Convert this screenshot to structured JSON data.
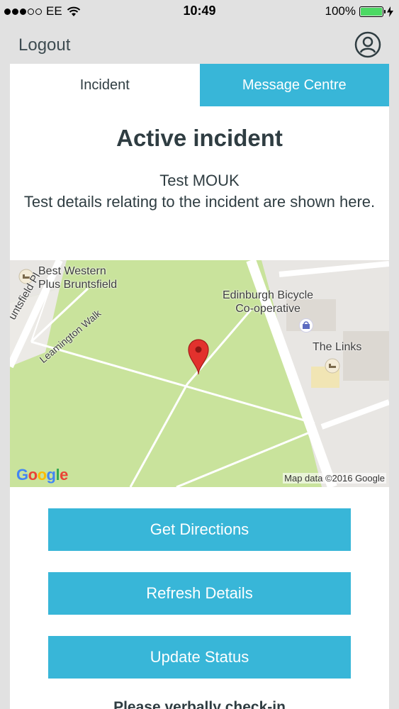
{
  "statusbar": {
    "carrier": "EE",
    "time": "10:49",
    "battery_percent": "100%",
    "battery_level": 1.0
  },
  "nav": {
    "logout_label": "Logout",
    "profile_icon": "user-circle-icon"
  },
  "tabs": [
    {
      "label": "Incident",
      "active": true
    },
    {
      "label": "Message Centre",
      "active": false
    }
  ],
  "incident": {
    "heading": "Active incident",
    "name": "Test MOUK",
    "details": "Test details relating to the incident are shown here."
  },
  "map": {
    "labels": {
      "hotel": "Best Western\nPlus Bruntsfield",
      "bicycle": "Edinburgh Bicycle\nCo-operative",
      "links": "The Links",
      "street1": "untsfield Pl",
      "street2": "Leamington Walk"
    },
    "logo": "Google",
    "attribution": "Map data ©2016 Google",
    "colors": {
      "park": "#c9e39c",
      "road": "#ffffff",
      "pin": "#e2312d"
    }
  },
  "buttons": {
    "directions": "Get Directions",
    "refresh": "Refresh Details",
    "status": "Update Status"
  },
  "footer": {
    "note": "Please verbally check-in"
  },
  "colors": {
    "accent": "#38b6d8",
    "text": "#2f3d42",
    "background": "#e1e1e1"
  }
}
